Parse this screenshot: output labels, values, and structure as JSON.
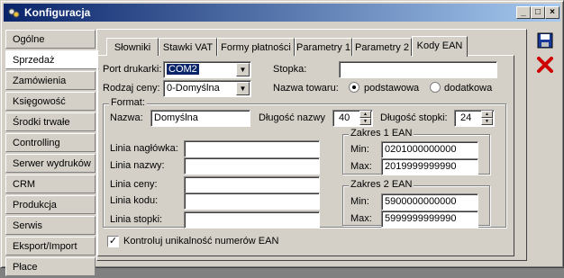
{
  "window": {
    "title": "Konfiguracja"
  },
  "sidebar": {
    "items": [
      {
        "label": "Ogólne"
      },
      {
        "label": "Sprzedaż"
      },
      {
        "label": "Zamówienia"
      },
      {
        "label": "Księgowość"
      },
      {
        "label": "Środki trwałe"
      },
      {
        "label": "Controlling"
      },
      {
        "label": "Serwer wydruków"
      },
      {
        "label": "CRM"
      },
      {
        "label": "Produkcja"
      },
      {
        "label": "Serwis"
      },
      {
        "label": "Eksport/Import"
      },
      {
        "label": "Płace"
      }
    ],
    "active": "Sprzedaż"
  },
  "tabs": [
    {
      "label": "Słowniki"
    },
    {
      "label": "Stawki VAT"
    },
    {
      "label": "Formy płatności"
    },
    {
      "label": "Parametry 1"
    },
    {
      "label": "Parametry 2"
    },
    {
      "label": "Kody EAN"
    }
  ],
  "form": {
    "port_label": "Port drukarki:",
    "port_value": "COM2",
    "price_label": "Rodzaj ceny:",
    "price_value": "0-Domyślna",
    "footer_label": "Stopka:",
    "footer_value": "",
    "product_name_label": "Nazwa towaru:",
    "radio_basic": "podstawowa",
    "radio_extra": "dodatkowa",
    "format_legend": "Format:",
    "name_label": "Nazwa:",
    "name_value": "Domyślna",
    "name_len_label": "Długość nazwy",
    "name_len_value": "40",
    "footer_len_label": "Długość stopki:",
    "footer_len_value": "24",
    "header_line_label": "Linia nagłówka:",
    "name_line_label": "Linia nazwy:",
    "price_line_label": "Linia ceny:",
    "code_line_label": "Linia kodu:",
    "footer_line_label": "Linia stopki:",
    "range1_legend": "Zakres 1 EAN",
    "range1_min_label": "Min:",
    "range1_min": "0201000000000",
    "range1_max_label": "Max:",
    "range1_max": "2019999999990",
    "range2_legend": "Zakres 2 EAN",
    "range2_min_label": "Min:",
    "range2_min": "5900000000000",
    "range2_max_label": "Max:",
    "range2_max": "5999999999990",
    "unique_check_label": "Kontroluj unikalność numerów EAN"
  },
  "colors": {
    "titlebar_start": "#0a246a",
    "titlebar_end": "#a6caf0",
    "save": "#1a3a9a",
    "close": "#cc0000"
  }
}
